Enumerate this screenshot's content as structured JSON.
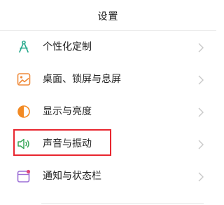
{
  "header": {
    "title": "设置"
  },
  "settings_items": [
    {
      "label": "个性化定制",
      "icon": "compass-icon",
      "icon_color": "#27a98c"
    },
    {
      "label": "桌面、锁屏与息屏",
      "icon": "wallpaper-icon",
      "icon_color": "#ef8a3a"
    },
    {
      "label": "显示与亮度",
      "icon": "brightness-icon",
      "icon_color": "#f28a24"
    },
    {
      "label": "声音与振动",
      "icon": "speaker-icon",
      "icon_color": "#3aa85a"
    },
    {
      "label": "通知与状态栏",
      "icon": "notification-icon",
      "icon_color": "#9c6fd6"
    }
  ],
  "highlight": {
    "target": "声音与振动",
    "color": "#e8262f"
  },
  "colors": {
    "chevron": "#c8c8c8",
    "divider": "#ececec",
    "text": "#222222"
  }
}
